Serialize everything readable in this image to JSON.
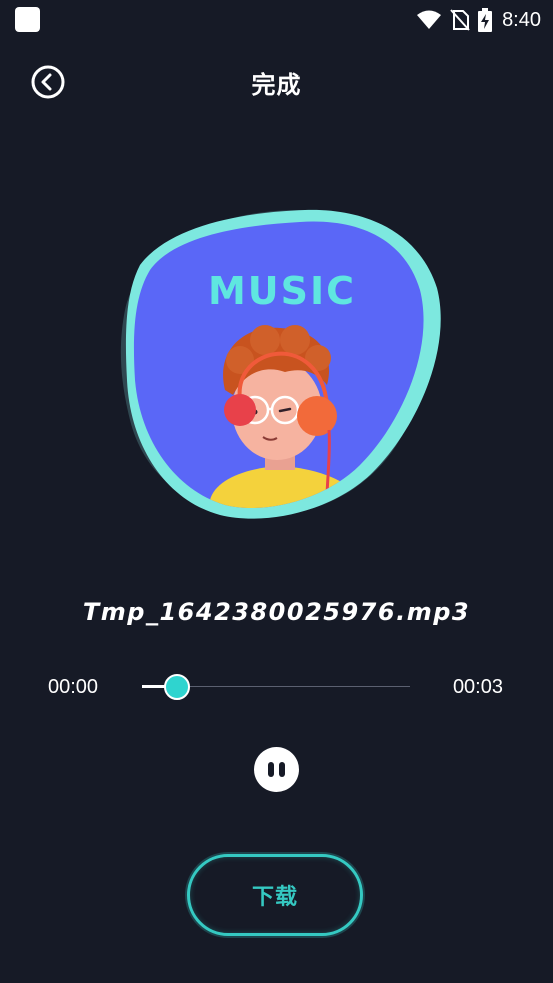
{
  "status_bar": {
    "time": "8:40",
    "icons": [
      "app-icon",
      "wifi-icon",
      "no-sim-icon",
      "battery-charging-icon"
    ]
  },
  "header": {
    "title": "完成",
    "back_icon": "back-circle-icon"
  },
  "artwork": {
    "text": "MUSIC",
    "colors": {
      "blob_outer": "#2f4750",
      "blob_ring": "#7de8df",
      "blob_inner": "#5a67f7",
      "music_text": "#5fe6e0"
    }
  },
  "player": {
    "file_name": "Tmp_1642380025976.mp3",
    "current_time": "00:00",
    "total_time": "00:03",
    "progress": 0.13,
    "state": "playing",
    "pause_icon": "pause-icon"
  },
  "actions": {
    "download_label": "下载"
  },
  "colors": {
    "background": "#161a26",
    "accent": "#35c9c2",
    "thumb": "#2fd4cf"
  }
}
